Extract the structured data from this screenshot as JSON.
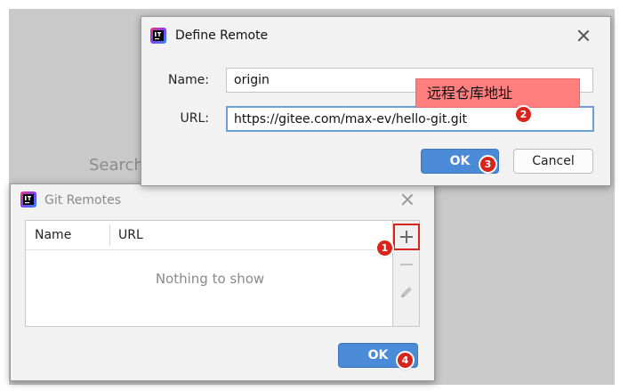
{
  "background": {
    "search_text": "Search"
  },
  "define_remote": {
    "title": "Define Remote",
    "name_label": "Name:",
    "name_value": "origin",
    "url_label": "URL:",
    "url_value": "https://gitee.com/max-ev/hello-git.git",
    "ok_label": "OK",
    "cancel_label": "Cancel"
  },
  "annotation": {
    "tooltip_text": "远程仓库地址"
  },
  "git_remotes": {
    "title": "Git Remotes",
    "columns": [
      "Name",
      "URL"
    ],
    "empty_text": "Nothing to show",
    "ok_label": "OK"
  },
  "badges": [
    "1",
    "2",
    "3",
    "4"
  ],
  "icons": {
    "app": "intellij-idea-icon",
    "add": "plus-icon",
    "remove": "minus-icon",
    "edit": "pencil-icon",
    "close": "close-icon"
  },
  "colors": {
    "accent": "#4a8ad6",
    "annotation": "#ff7f7f",
    "badge": "#d9241c"
  }
}
